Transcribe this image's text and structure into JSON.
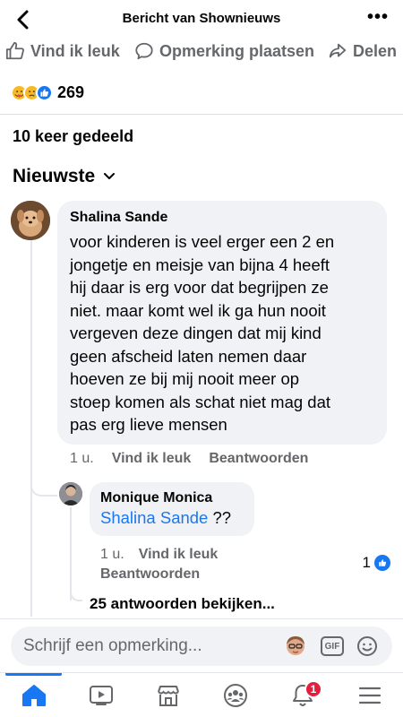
{
  "header": {
    "title": "Bericht van Shownieuws",
    "back_icon": "chevron-left-icon",
    "more_icon": "more-horizontal-icon",
    "more_label": "•••"
  },
  "post_actions": {
    "like_label": "Vind ik leuk",
    "comment_label": "Opmerking plaatsen",
    "share_label": "Delen"
  },
  "reactions": {
    "types": [
      "care",
      "sad",
      "like"
    ],
    "count": "269"
  },
  "shares_text": "10 keer gedeeld",
  "sort": {
    "label": "Nieuwste",
    "icon": "chevron-down-icon"
  },
  "comments": [
    {
      "author": "Shalina Sande",
      "text": "voor kinderen  is veel erger een 2 en\njongetje en meisje van bijna 4 heeft\nhij daar is erg voor dat begrijpen ze\nniet. maar komt wel  ik ga hun nooit\nvergeven deze dingen dat mij kind\ngeen afscheid  laten nemen  daar\nhoeven ze bij mij nooit meer op\nstoep komen als schat niet mag dat\npas erg lieve mensen",
      "time": "1 u.",
      "like_label": "Vind ik leuk",
      "reply_label": "Beantwoorden",
      "replies": [
        {
          "author": "Monique Monica",
          "mention": "Shalina Sande",
          "text": " ??",
          "time": "1 u.",
          "like_label": "Vind ik leuk",
          "reply_label": "Beantwoorden",
          "like_count": "1"
        }
      ],
      "view_more_label": "25 antwoorden bekijken..."
    }
  ],
  "composer": {
    "placeholder": "Schrijf een opmerking...",
    "gif_label": "GIF"
  },
  "tabbar": {
    "tabs": [
      "home-icon",
      "video-icon",
      "marketplace-icon",
      "groups-icon",
      "notifications-icon",
      "menu-icon"
    ],
    "active": "home-icon",
    "notification_badge": "1"
  },
  "colors": {
    "accent": "#1877f2",
    "secondary_text": "#65676b",
    "bubble": "#f0f2f5",
    "badge": "#e41e3f"
  }
}
